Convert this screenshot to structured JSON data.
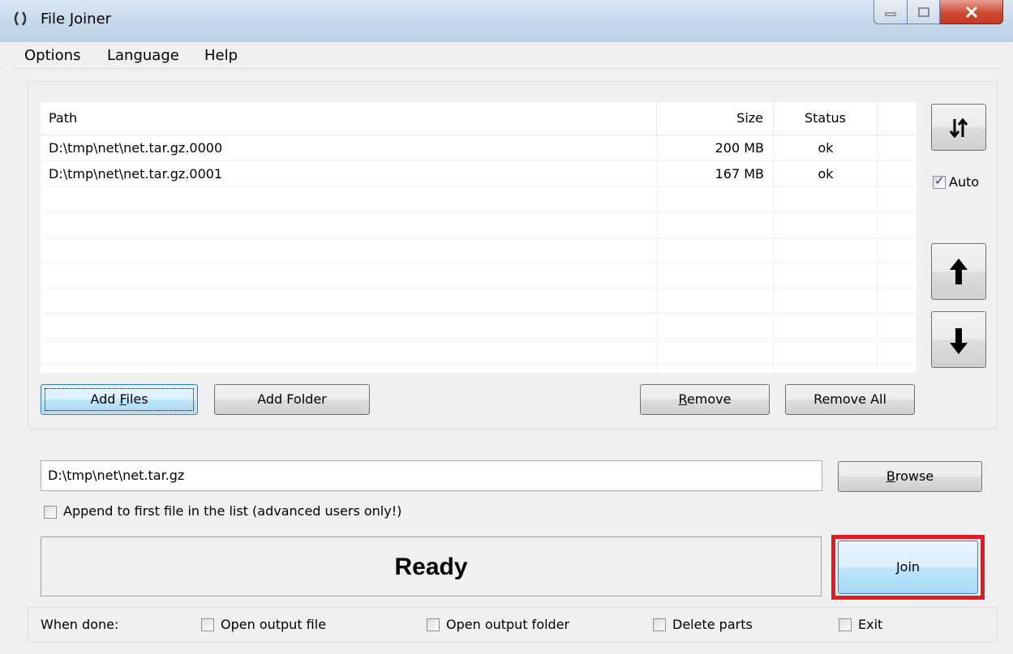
{
  "window": {
    "title": "File Joiner",
    "accent_color": "#3c7fb1",
    "highlight_color": "#e21b23"
  },
  "menu": {
    "items": [
      "Options",
      "Language",
      "Help"
    ]
  },
  "file_list": {
    "columns": [
      "Path",
      "Size",
      "Status"
    ],
    "rows": [
      {
        "path": "D:\\tmp\\net\\net.tar.gz.0000",
        "size": "200 MB",
        "status": "ok"
      },
      {
        "path": "D:\\tmp\\net\\net.tar.gz.0001",
        "size": "167 MB",
        "status": "ok"
      }
    ]
  },
  "sidebar": {
    "sort_icon": "sort-arrows-icon",
    "auto_label": "Auto",
    "auto_checked": true,
    "up_icon": "arrow-up-icon",
    "down_icon": "arrow-down-icon"
  },
  "buttons": {
    "add_files_pre": "Add ",
    "add_files_accel": "F",
    "add_files_post": "iles",
    "add_folder": "Add Folder",
    "remove_accel": "R",
    "remove_post": "emove",
    "remove_all": "Remove All",
    "browse_accel": "B",
    "browse_post": "rowse",
    "join_accel": "J",
    "join_post": "oin"
  },
  "output": {
    "path": "D:\\tmp\\net\\net.tar.gz",
    "append_label": "Append to first file in the list (advanced users only!)",
    "append_checked": false
  },
  "status": {
    "text": "Ready"
  },
  "when_done": {
    "label": "When done:",
    "options": [
      {
        "label": "Open output file",
        "checked": false
      },
      {
        "label": "Open output folder",
        "checked": false
      },
      {
        "label": "Delete parts",
        "checked": false
      },
      {
        "label": "Exit",
        "checked": false
      }
    ]
  }
}
